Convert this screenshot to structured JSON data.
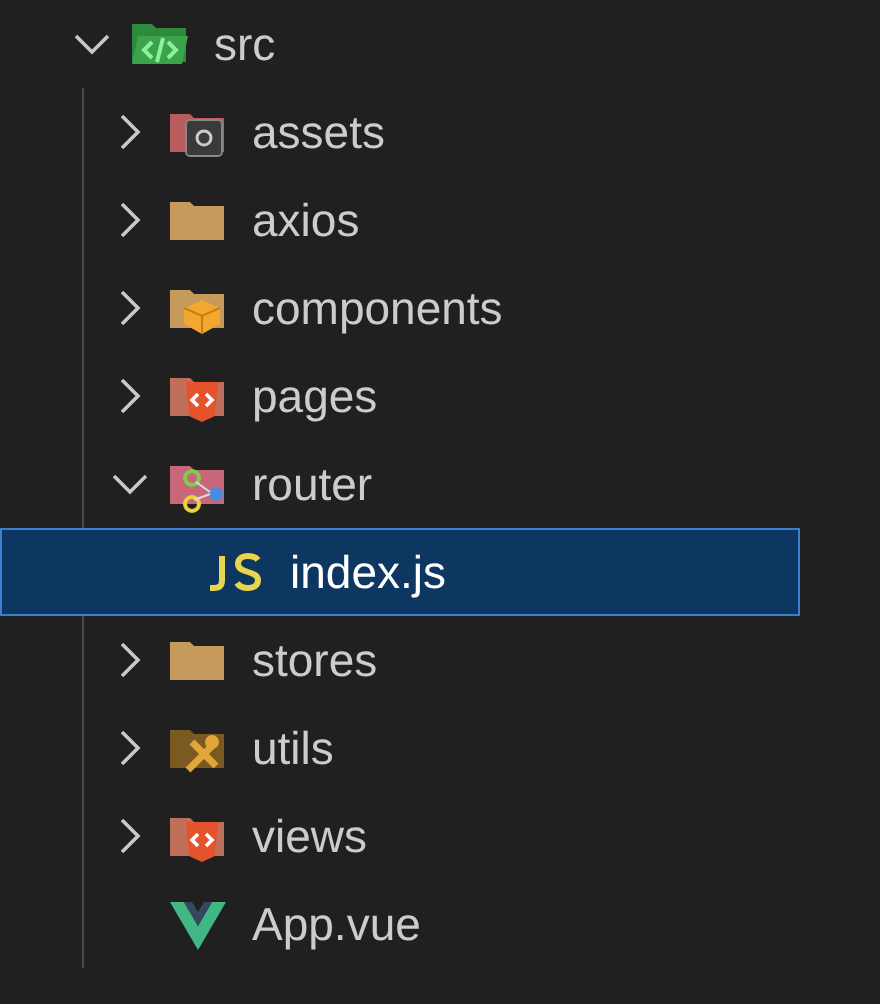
{
  "tree": [
    {
      "name": "src",
      "kind": "source",
      "expanded": true,
      "selected": false,
      "children": [
        {
          "name": "assets",
          "kind": "assets",
          "expanded": false,
          "selected": false
        },
        {
          "name": "axios",
          "kind": "plain",
          "expanded": false,
          "selected": false
        },
        {
          "name": "components",
          "kind": "components",
          "expanded": false,
          "selected": false
        },
        {
          "name": "pages",
          "kind": "pages",
          "expanded": false,
          "selected": false
        },
        {
          "name": "router",
          "kind": "router",
          "expanded": true,
          "selected": false,
          "children": [
            {
              "name": "index.js",
              "kind": "js",
              "selected": true
            }
          ]
        },
        {
          "name": "stores",
          "kind": "plain",
          "expanded": false,
          "selected": false
        },
        {
          "name": "utils",
          "kind": "tools",
          "expanded": false,
          "selected": false
        },
        {
          "name": "views",
          "kind": "pages",
          "expanded": false,
          "selected": false
        },
        {
          "name": "App.vue",
          "kind": "vue",
          "selected": false
        }
      ]
    }
  ]
}
